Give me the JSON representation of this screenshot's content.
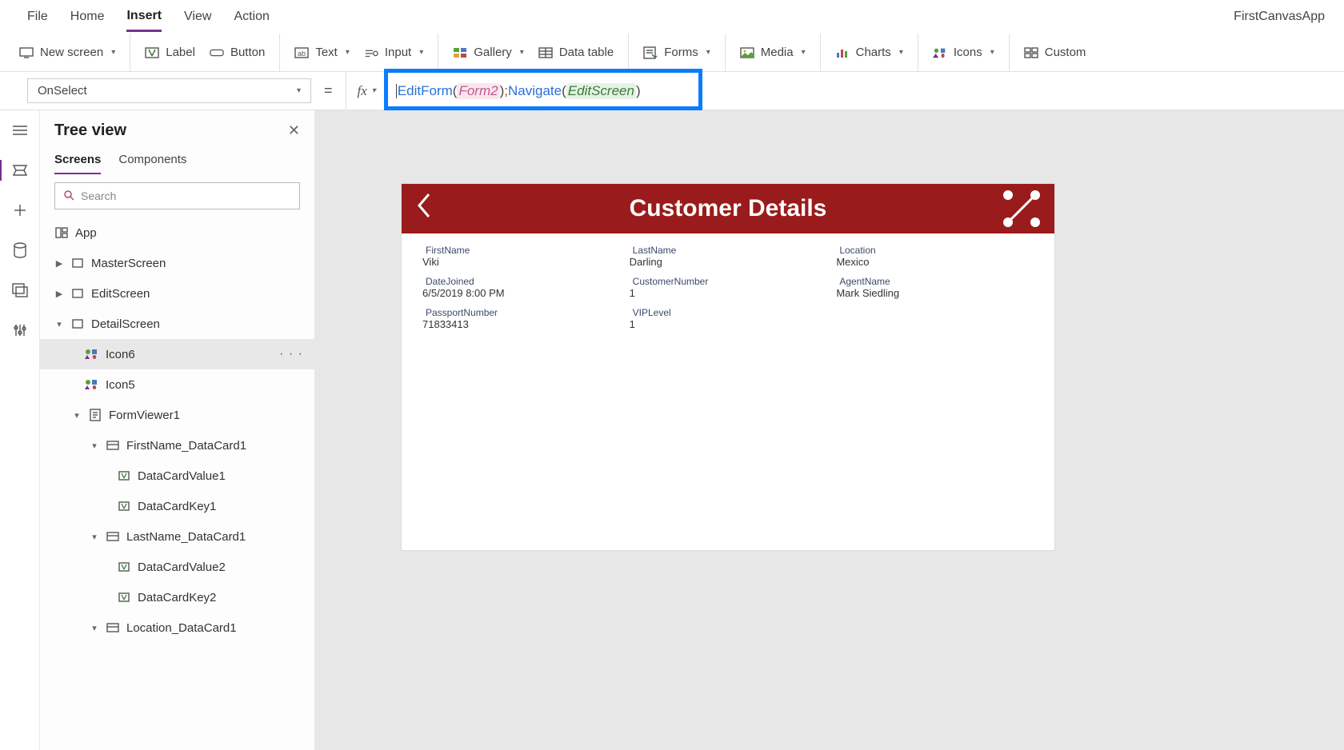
{
  "app_title": "FirstCanvasApp",
  "menu": {
    "file": "File",
    "home": "Home",
    "insert": "Insert",
    "view": "View",
    "action": "Action"
  },
  "ribbon": {
    "new_screen": "New screen",
    "label": "Label",
    "button": "Button",
    "text": "Text",
    "input": "Input",
    "gallery": "Gallery",
    "data_table": "Data table",
    "forms": "Forms",
    "media": "Media",
    "charts": "Charts",
    "icons": "Icons",
    "custom": "Custom"
  },
  "property_selected": "OnSelect",
  "formula": {
    "fn1": "EditForm",
    "arg1": "Form2",
    "fn2": "Navigate",
    "arg2": "EditScreen"
  },
  "tree_panel": {
    "title": "Tree view",
    "tabs": {
      "screens": "Screens",
      "components": "Components"
    },
    "search_placeholder": "Search",
    "items": {
      "app": "App",
      "master": "MasterScreen",
      "edit": "EditScreen",
      "detail": "DetailScreen",
      "icon6": "Icon6",
      "icon5": "Icon5",
      "formviewer": "FormViewer1",
      "fn_card": "FirstName_DataCard1",
      "fn_val": "DataCardValue1",
      "fn_key": "DataCardKey1",
      "ln_card": "LastName_DataCard1",
      "ln_val": "DataCardValue2",
      "ln_key": "DataCardKey2",
      "loc_card": "Location_DataCard1"
    }
  },
  "screen": {
    "title": "Customer Details",
    "fields": {
      "firstName": {
        "label": "FirstName",
        "value": "Viki"
      },
      "lastName": {
        "label": "LastName",
        "value": "Darling"
      },
      "location": {
        "label": "Location",
        "value": "Mexico"
      },
      "dateJoined": {
        "label": "DateJoined",
        "value": "6/5/2019 8:00 PM"
      },
      "customerNumber": {
        "label": "CustomerNumber",
        "value": "1"
      },
      "agentName": {
        "label": "AgentName",
        "value": "Mark Siedling"
      },
      "passportNumber": {
        "label": "PassportNumber",
        "value": "71833413"
      },
      "vipLevel": {
        "label": "VIPLevel",
        "value": "1"
      }
    }
  }
}
